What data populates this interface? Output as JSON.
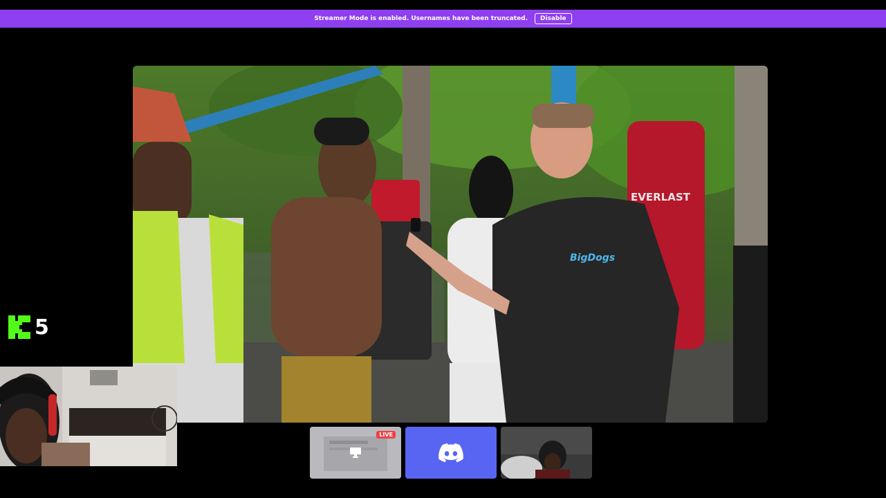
{
  "banner": {
    "message": "Streamer Mode is enabled. Usernames have been truncated.",
    "disable_label": "Disable"
  },
  "overlay": {
    "kick_count": "5"
  },
  "main_video": {
    "shirt_text": "BigDogs",
    "bag_text": "EVERLAST"
  },
  "tiles": {
    "screen_live_badge": "LIVE"
  },
  "colors": {
    "banner": "#8e3ff0",
    "kick_green": "#53fc18",
    "discord_blurple": "#5865f2",
    "live_red": "#ed4245"
  }
}
